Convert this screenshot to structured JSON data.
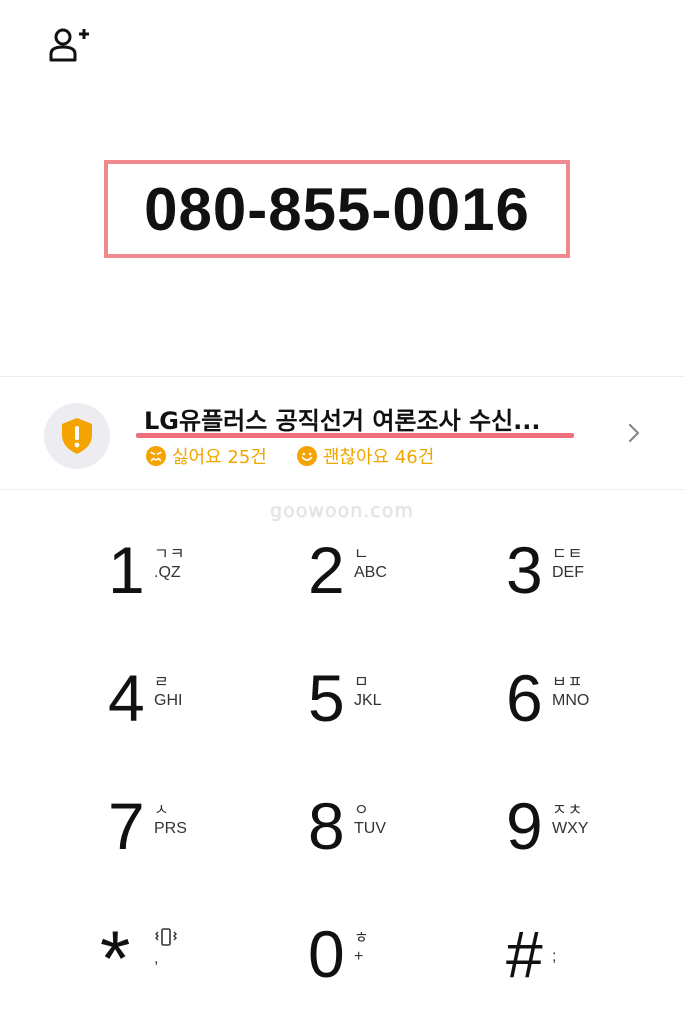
{
  "dialed_number": "080-855-0016",
  "caller_info": {
    "name": "LG유플러스 공직선거 여론조사 수신...",
    "dislike_label": "싫어요 25건",
    "like_label": "괜찮아요 46건",
    "accent_color": "#f0a500",
    "icon": "shield-warning-icon"
  },
  "watermark": "goowoon.com",
  "keypad": [
    {
      "digit": "1",
      "sub1": "ㄱㅋ",
      "sub2": ".QZ"
    },
    {
      "digit": "2",
      "sub1": "ㄴ",
      "sub2": "ABC"
    },
    {
      "digit": "3",
      "sub1": "ㄷㅌ",
      "sub2": "DEF"
    },
    {
      "digit": "4",
      "sub1": "ㄹ",
      "sub2": "GHI"
    },
    {
      "digit": "5",
      "sub1": "ㅁ",
      "sub2": "JKL"
    },
    {
      "digit": "6",
      "sub1": "ㅂㅍ",
      "sub2": "MNO"
    },
    {
      "digit": "7",
      "sub1": "ㅅ",
      "sub2": "PRS"
    },
    {
      "digit": "8",
      "sub1": "ㅇ",
      "sub2": "TUV"
    },
    {
      "digit": "9",
      "sub1": "ㅈㅊ",
      "sub2": "WXY"
    },
    {
      "digit": "*",
      "sub1": "",
      "sub2": ","
    },
    {
      "digit": "0",
      "sub1": "ㅎ",
      "sub2": "+"
    },
    {
      "digit": "#",
      "sub1": "",
      "sub2": ";"
    }
  ]
}
